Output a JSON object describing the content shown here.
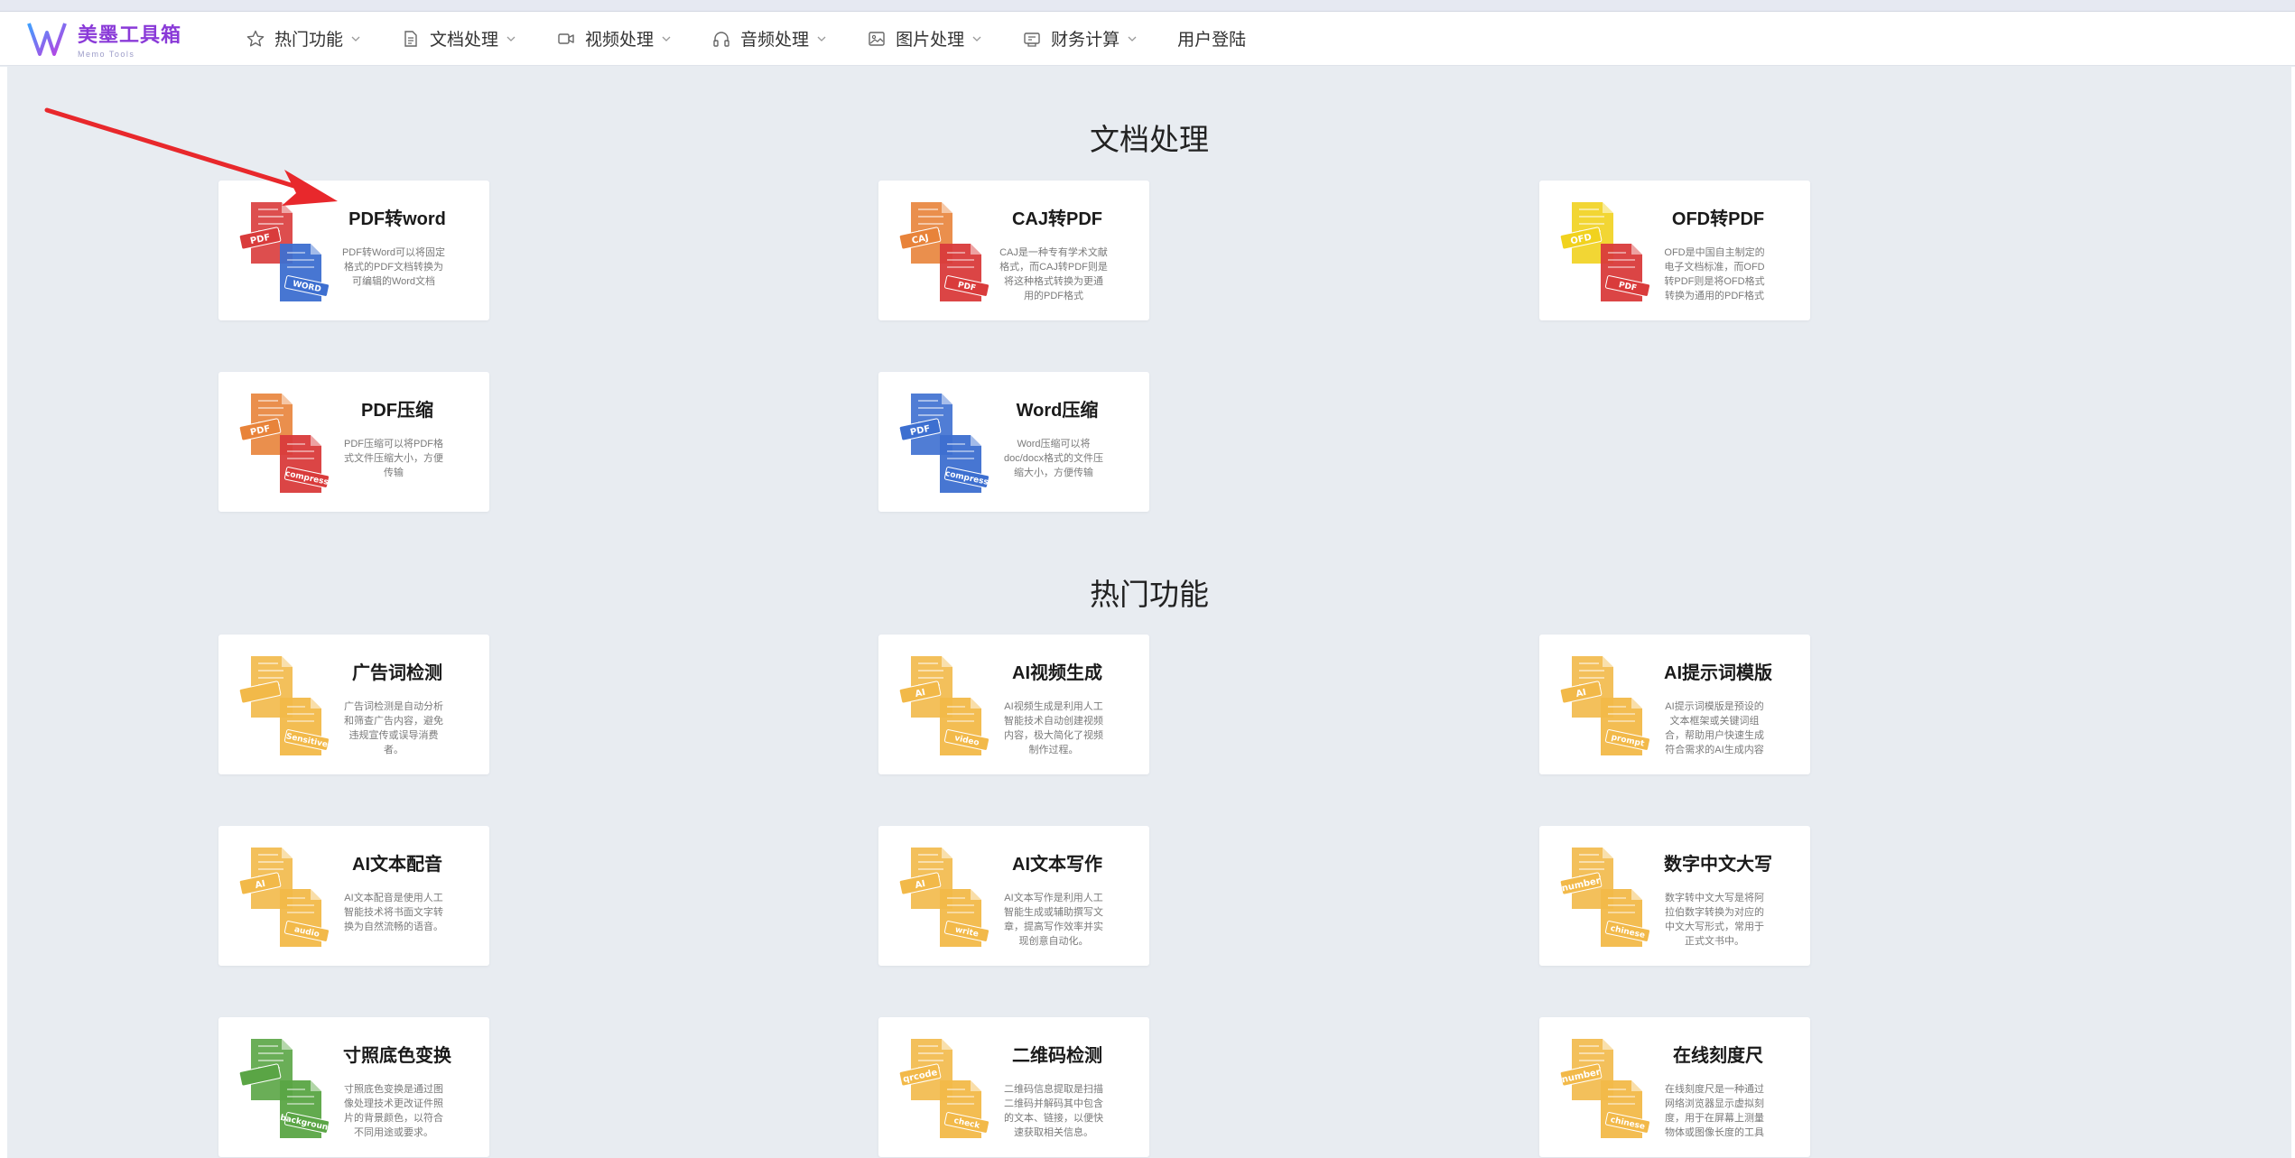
{
  "brand": {
    "title": "美墨工具箱",
    "subtitle": "Memo Tools",
    "accent": "#8a3ad8"
  },
  "nav": [
    {
      "label": "热门功能",
      "icon": "star-icon"
    },
    {
      "label": "文档处理",
      "icon": "document-icon"
    },
    {
      "label": "视频处理",
      "icon": "video-icon"
    },
    {
      "label": "音频处理",
      "icon": "headphones-icon"
    },
    {
      "label": "图片处理",
      "icon": "image-icon"
    },
    {
      "label": "财务计算",
      "icon": "calculator-icon"
    }
  ],
  "login": "用户登陆",
  "sections": [
    {
      "title": "文档处理",
      "cards": [
        {
          "title": "PDF转word",
          "desc": "PDF转Word可以将固定格式的PDF文档转换为可编辑的Word文档",
          "tag1": "PDF",
          "tag2": "WORD"
        },
        {
          "title": "CAJ转PDF",
          "desc": "CAJ是一种专有学术文献格式，而CAJ转PDF则是将这种格式转换为更通用的PDF格式",
          "tag1": "CAJ",
          "tag2": "PDF"
        },
        {
          "title": "OFD转PDF",
          "desc": "OFD是中国自主制定的电子文档标准，而OFD转PDF则是将OFD格式转换为通用的PDF格式",
          "tag1": "OFD",
          "tag2": "PDF"
        },
        {
          "title": "PDF压缩",
          "desc": "PDF压缩可以将PDF格式文件压缩大小，方便传输",
          "tag1": "PDF",
          "tag2": "compress"
        },
        {
          "title": "Word压缩",
          "desc": "Word压缩可以将doc/docx格式的文件压缩大小，方便传输",
          "tag1": "PDF",
          "tag2": "compress"
        }
      ]
    },
    {
      "title": "热门功能",
      "cards": [
        {
          "title": "广告词检测",
          "desc": "广告词检测是自动分析和筛查广告内容，避免违规宣传或误导消费者。",
          "tag1": "",
          "tag2": "Sensitive"
        },
        {
          "title": "AI视频生成",
          "desc": "AI视频生成是利用人工智能技术自动创建视频内容，极大简化了视频制作过程。",
          "tag1": "AI",
          "tag2": "video"
        },
        {
          "title": "AI提示词模版",
          "desc": "AI提示词模版是预设的文本框架或关键词组合，帮助用户快速生成符合需求的AI生成内容",
          "tag1": "AI",
          "tag2": "prompt"
        },
        {
          "title": "AI文本配音",
          "desc": "AI文本配音是使用人工智能技术将书面文字转换为自然流畅的语音。",
          "tag1": "AI",
          "tag2": "audio"
        },
        {
          "title": "AI文本写作",
          "desc": "AI文本写作是利用人工智能生成或辅助撰写文章，提高写作效率并实现创意自动化。",
          "tag1": "AI",
          "tag2": "write"
        },
        {
          "title": "数字中文大写",
          "desc": "数字转中文大写是将阿拉伯数字转换为对应的中文大写形式，常用于正式文书中。",
          "tag1": "number",
          "tag2": "chinese"
        },
        {
          "title": "寸照底色变换",
          "desc": "寸照底色变换是通过图像处理技术更改证件照片的背景颜色，以符合不同用途或要求。",
          "tag1": "",
          "tag2": "background"
        },
        {
          "title": "二维码检测",
          "desc": "二维码信息提取是扫描二维码并解码其中包含的文本、链接，以便快速获取相关信息。",
          "tag1": "qrcode",
          "tag2": "check"
        },
        {
          "title": "在线刻度尺",
          "desc": "在线刻度尺是一种通过网络浏览器显示虚拟刻度，用于在屏幕上测量物体或图像长度的工具",
          "tag1": "number",
          "tag2": "chinese"
        }
      ]
    }
  ],
  "icon_colors": {
    "pdf_red": "#d93b3b",
    "word_blue": "#3d6fd0",
    "orange": "#e8833a",
    "yellow": "#f1d21e",
    "gold": "#f2b949",
    "green": "#5aa545"
  }
}
